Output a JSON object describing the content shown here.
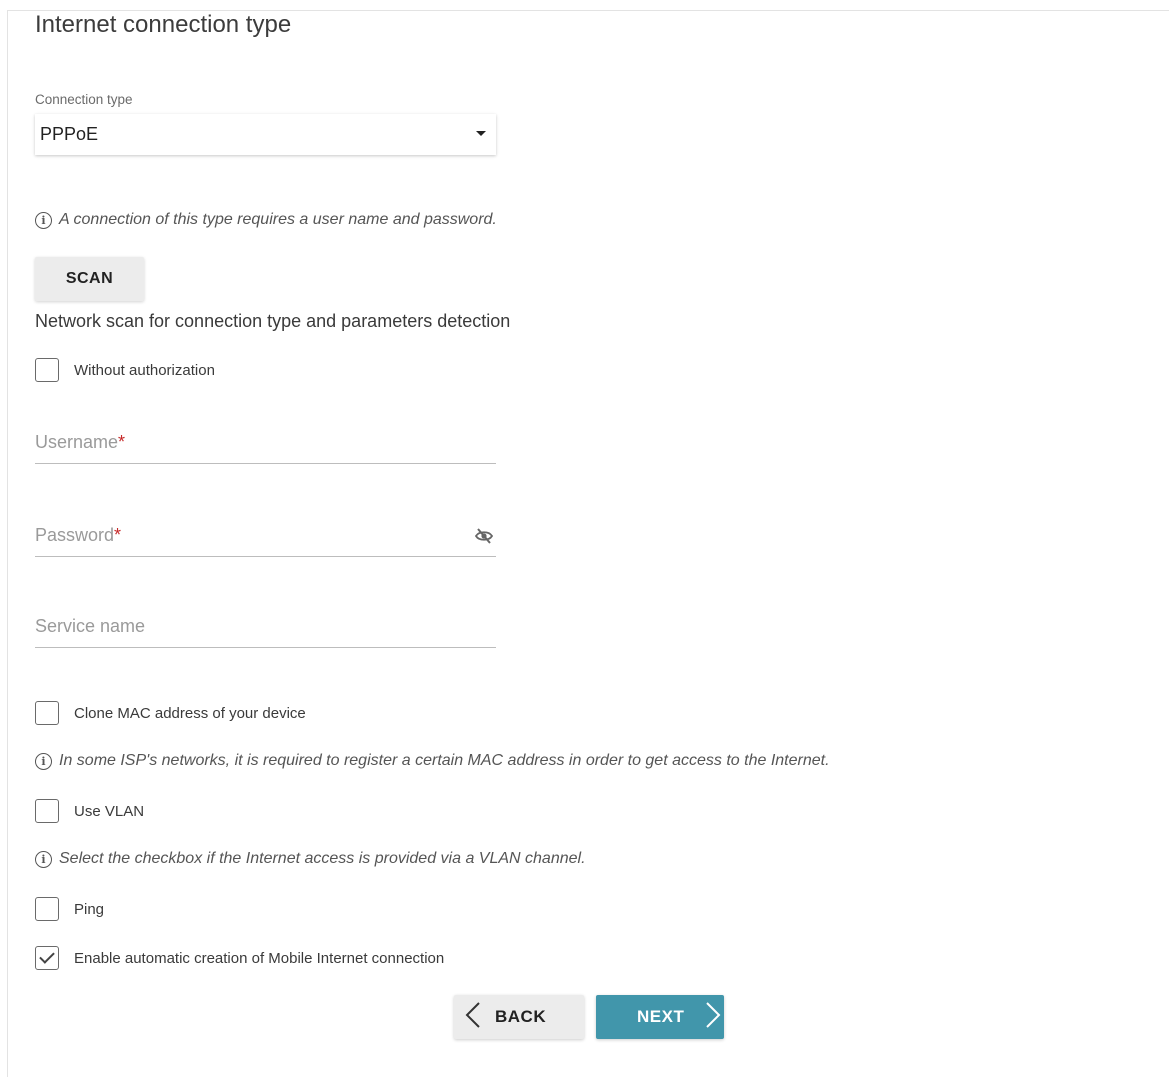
{
  "page": {
    "title": "Internet connection type"
  },
  "connection": {
    "caption": "Connection type",
    "selected": "PPPoE",
    "info": "A connection of this type requires a user name and password."
  },
  "scan": {
    "button_label": "SCAN",
    "description": "Network scan for connection type and parameters detection"
  },
  "checkboxes": {
    "without_auth": {
      "label": "Without authorization",
      "checked": false
    },
    "clone_mac": {
      "label": "Clone MAC address of your device",
      "checked": false
    },
    "use_vlan": {
      "label": "Use VLAN",
      "checked": false
    },
    "ping": {
      "label": "Ping",
      "checked": false
    },
    "mobile_auto": {
      "label": "Enable automatic creation of Mobile Internet connection",
      "checked": true
    }
  },
  "fields": {
    "username": {
      "label": "Username",
      "required_mark": "*",
      "value": ""
    },
    "password": {
      "label": "Password",
      "required_mark": "*",
      "value": "",
      "icon": "eye-off-icon"
    },
    "service_name": {
      "label": "Service name",
      "value": ""
    }
  },
  "info": {
    "info_icon_glyph": "i",
    "mac_note": "In some ISP's networks, it is required to register a certain MAC address in order to get access to the Internet.",
    "vlan_note": "Select the checkbox if the Internet access is provided via a VLAN channel."
  },
  "nav": {
    "back_label": "BACK",
    "next_label": "NEXT"
  },
  "colors": {
    "accent": "#4196ab",
    "required": "#c62828",
    "button_gray": "#ececec"
  }
}
